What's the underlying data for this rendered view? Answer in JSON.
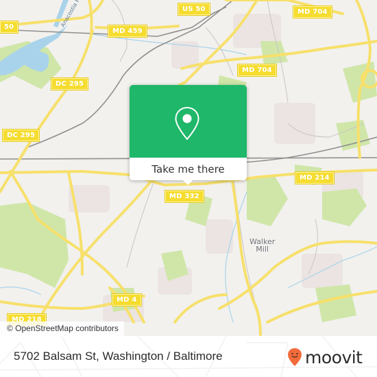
{
  "map": {
    "road_labels": [
      {
        "id": "us-50-left",
        "text": "50"
      },
      {
        "id": "md-459",
        "text": "MD 459"
      },
      {
        "id": "us-50",
        "text": "US 50"
      },
      {
        "id": "md-704-top",
        "text": "MD 704"
      },
      {
        "id": "md-704",
        "text": "MD 704"
      },
      {
        "id": "dc-295-upper",
        "text": "DC 295"
      },
      {
        "id": "dc-295-lower",
        "text": "DC 295"
      },
      {
        "id": "md-214",
        "text": "MD 214"
      },
      {
        "id": "md-332",
        "text": "MD 332"
      },
      {
        "id": "md-4",
        "text": "MD 4"
      },
      {
        "id": "md-218",
        "text": "MD 218"
      }
    ],
    "river_label": "Anacostia River",
    "place_labels": [
      {
        "id": "walker-mill",
        "text": "Walker\nMill"
      }
    ],
    "attribution": "© OpenStreetMap contributors",
    "colors": {
      "land": "#f2f1ee",
      "park": "#cfe6a8",
      "water": "#a9d3ea",
      "road": "#f7e06b",
      "residential": "#ebe4e2"
    }
  },
  "popup": {
    "icon": "map-pin-icon",
    "button_label": "Take me there",
    "accent": "#1fb76a"
  },
  "footer": {
    "address": "5702 Balsam St, Washington / Baltimore",
    "brand_name": "moovit",
    "brand_color": "#f26b3a"
  }
}
